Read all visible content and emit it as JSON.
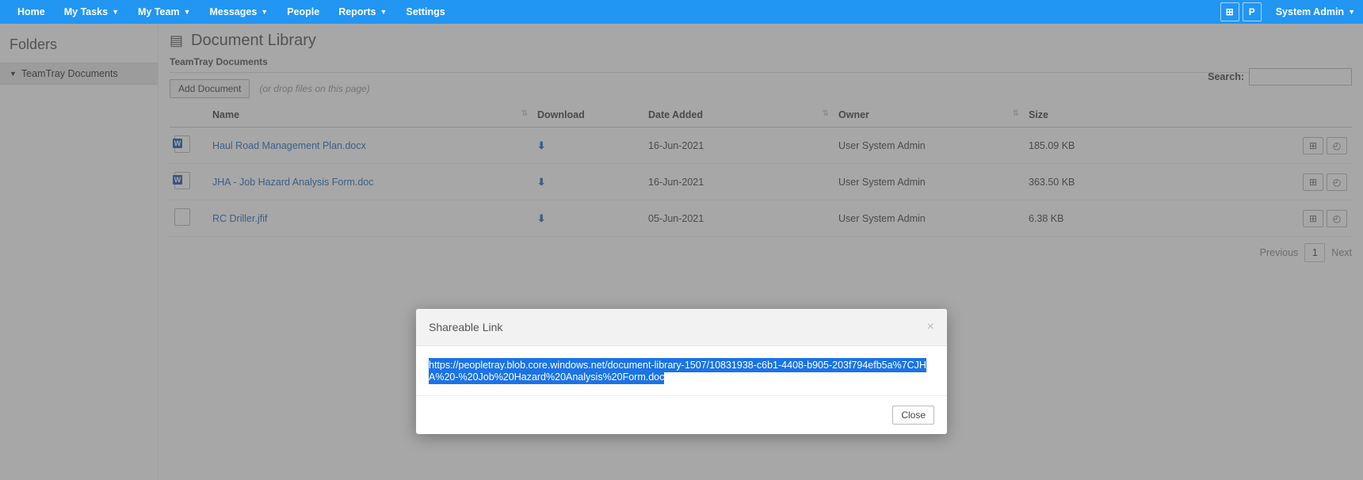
{
  "nav": {
    "home": "Home",
    "my_tasks": "My Tasks",
    "my_team": "My Team",
    "messages": "Messages",
    "people": "People",
    "reports": "Reports",
    "settings": "Settings",
    "grid_btn": "⊞",
    "p_btn": "P",
    "user": "System Admin"
  },
  "sidebar": {
    "heading": "Folders",
    "items": [
      "TeamTray Documents"
    ]
  },
  "page": {
    "title": "Document Library",
    "subtitle": "TeamTray Documents",
    "add_btn": "Add Document",
    "drop_hint": "(or drop files on this page)",
    "search_label": "Search:",
    "search_value": ""
  },
  "table": {
    "cols": {
      "name": "Name",
      "download": "Download",
      "date": "Date Added",
      "owner": "Owner",
      "size": "Size"
    },
    "rows": [
      {
        "icon": "word",
        "name": "Haul Road Management Plan.docx",
        "date": "16-Jun-2021",
        "owner": "User System Admin",
        "size": "185.09 KB"
      },
      {
        "icon": "word",
        "name": "JHA - Job Hazard Analysis Form.doc",
        "date": "16-Jun-2021",
        "owner": "User System Admin",
        "size": "363.50 KB"
      },
      {
        "icon": "blank",
        "name": "RC Driller.jfif",
        "date": "05-Jun-2021",
        "owner": "User System Admin",
        "size": "6.38 KB"
      }
    ]
  },
  "paging": {
    "prev": "Previous",
    "page": "1",
    "next": "Next"
  },
  "modal": {
    "title": "Shareable Link",
    "link": "https://peopletray.blob.core.windows.net/document-library-1507/10831938-c6b1-4408-b905-203f794efb5a%7CJHA%20-%20Job%20Hazard%20Analysis%20Form.doc",
    "close": "Close"
  }
}
